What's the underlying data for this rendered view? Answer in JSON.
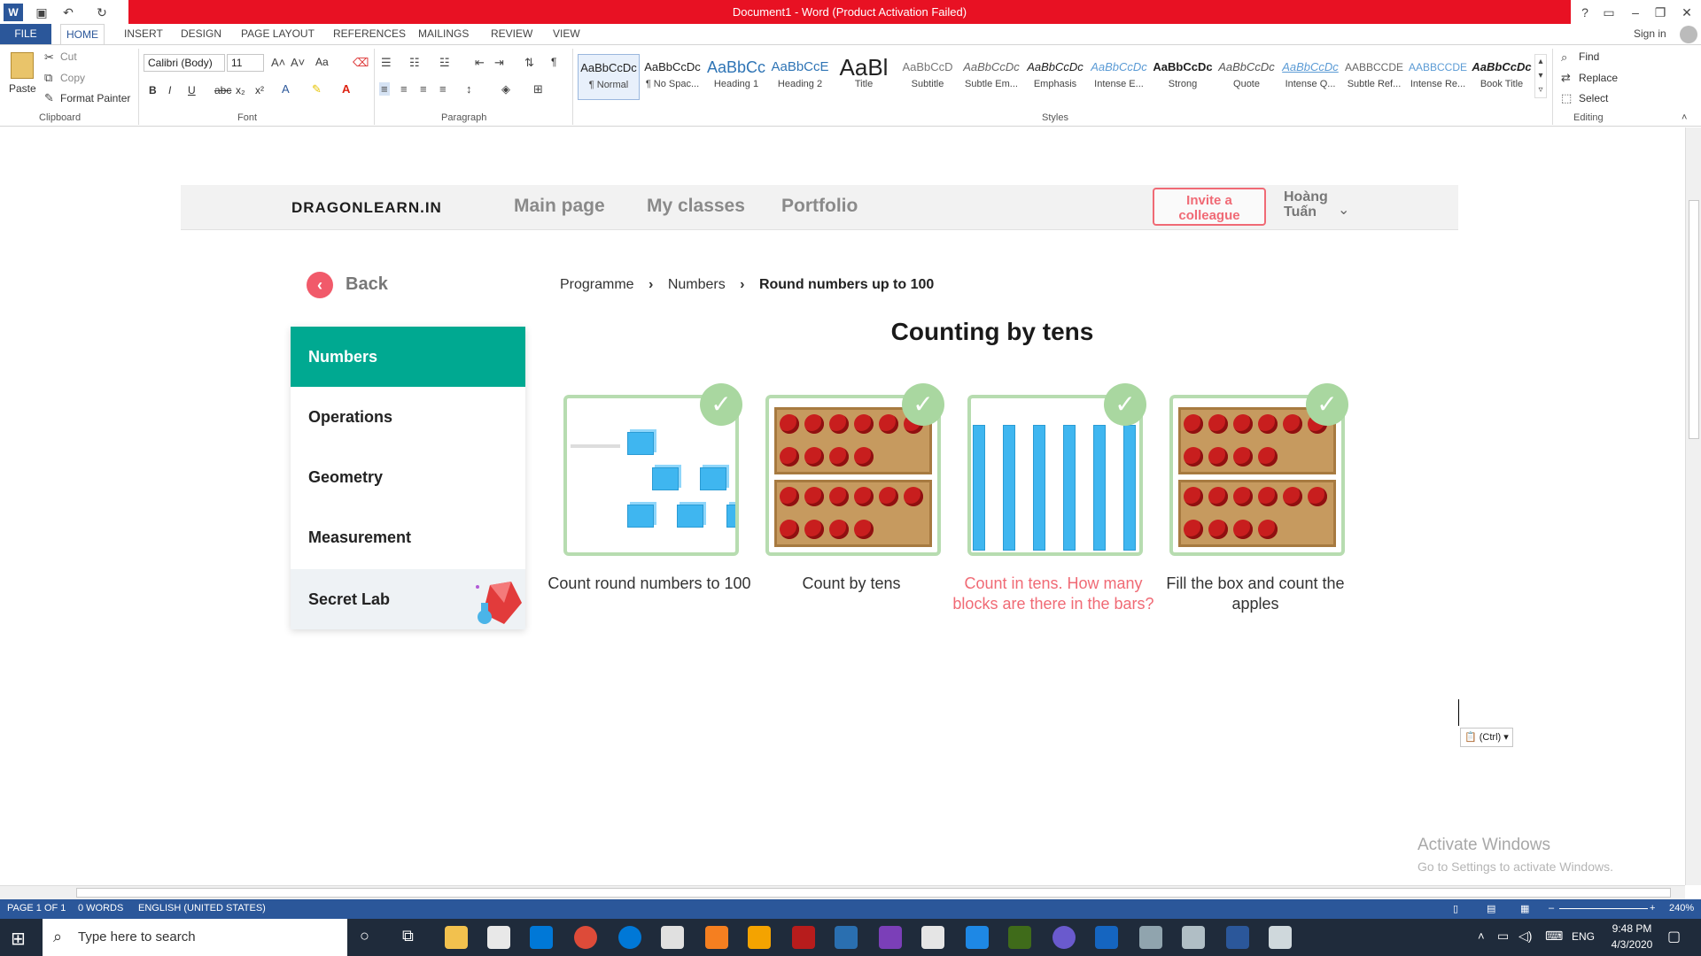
{
  "window": {
    "title": "Document1 - Word (Product Activation Failed)",
    "help": "?",
    "sign_in": "Sign in"
  },
  "ribbon_tabs": [
    "FILE",
    "HOME",
    "INSERT",
    "DESIGN",
    "PAGE LAYOUT",
    "REFERENCES",
    "MAILINGS",
    "REVIEW",
    "VIEW"
  ],
  "clipboard": {
    "paste": "Paste",
    "cut": "Cut",
    "copy": "Copy",
    "format_painter": "Format Painter",
    "label": "Clipboard"
  },
  "font": {
    "family": "Calibri (Body)",
    "size": "11",
    "label": "Font",
    "bold": "B",
    "italic": "I",
    "underline": "U",
    "strike": "abc",
    "sub": "x₂",
    "sup": "x²",
    "change_case": "Aa"
  },
  "paragraph": {
    "label": "Paragraph",
    "pilcrow": "¶"
  },
  "styles": {
    "label": "Styles",
    "items": [
      {
        "preview": "AaBbCcDc",
        "name": "¶ Normal"
      },
      {
        "preview": "AaBbCcDc",
        "name": "¶ No Spac..."
      },
      {
        "preview": "AaBbCc",
        "name": "Heading 1"
      },
      {
        "preview": "AaBbCcE",
        "name": "Heading 2"
      },
      {
        "preview": "AaBl",
        "name": "Title"
      },
      {
        "preview": "AaBbCcD",
        "name": "Subtitle"
      },
      {
        "preview": "AaBbCcDc",
        "name": "Subtle Em..."
      },
      {
        "preview": "AaBbCcDc",
        "name": "Emphasis"
      },
      {
        "preview": "AaBbCcDc",
        "name": "Intense E..."
      },
      {
        "preview": "AaBbCcDc",
        "name": "Strong"
      },
      {
        "preview": "AaBbCcDc",
        "name": "Quote"
      },
      {
        "preview": "AaBbCcDc",
        "name": "Intense Q..."
      },
      {
        "preview": "AABBCCDE",
        "name": "Subtle Ref..."
      },
      {
        "preview": "AABBCCDE",
        "name": "Intense Re..."
      },
      {
        "preview": "AaBbCcDc",
        "name": "Book Title"
      }
    ]
  },
  "editing": {
    "find": "Find",
    "replace": "Replace",
    "select": "Select",
    "label": "Editing"
  },
  "site": {
    "logo": "DRAGONLEARN.IN",
    "nav": [
      "Main page",
      "My classes",
      "Portfolio"
    ],
    "invite_line1": "Invite a",
    "invite_line2": "colleague",
    "user_line1": "Hoàng",
    "user_line2": "Tuấn",
    "back": "Back",
    "breadcrumb": [
      "Programme",
      "Numbers",
      "Round numbers up to 100"
    ],
    "sidebar": [
      "Numbers",
      "Operations",
      "Geometry",
      "Measurement",
      "Secret Lab"
    ],
    "heading": "Counting by tens",
    "cards": [
      {
        "label": "Count round numbers to 100"
      },
      {
        "label": "Count by tens"
      },
      {
        "label": "Count in tens. How many blocks are there in the bars?"
      },
      {
        "label": "Fill the box and count the apples"
      }
    ]
  },
  "paste_options": "(Ctrl)",
  "watermark": {
    "line1": "Activate Windows",
    "line2": "Go to Settings to activate Windows."
  },
  "status": {
    "page": "PAGE 1 OF 1",
    "words": "0 WORDS",
    "language": "ENGLISH (UNITED STATES)",
    "zoom": "240%"
  },
  "taskbar": {
    "search_placeholder": "Type here to search",
    "lang": "ENG",
    "time": "9:48 PM",
    "date": "4/3/2020"
  },
  "colors": {
    "accent_teal": "#00a991",
    "accent_red": "#f06a75",
    "word_blue": "#2b579a",
    "title_red": "#e81123"
  }
}
